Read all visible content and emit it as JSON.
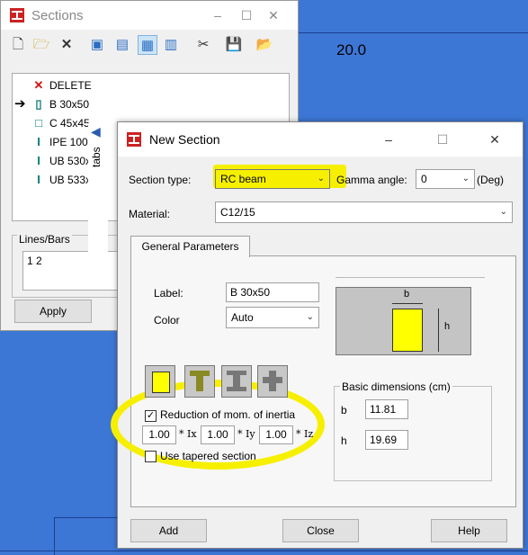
{
  "background": {
    "ruler_value": "20.0"
  },
  "sections_window": {
    "title": "Sections",
    "toolbar_icons": [
      "new-icon",
      "open-folder-icon",
      "delete-x-icon",
      "view-1-icon",
      "view-2-icon",
      "view-3-icon",
      "table-icon",
      "cut-icon",
      "save-icon",
      "folder-new-icon"
    ],
    "items": [
      {
        "label": "DELETE",
        "icon": "delete-x-icon",
        "current": false
      },
      {
        "label": "B 30x50",
        "icon": "rect-icon",
        "current": true
      },
      {
        "label": "C 45x45",
        "icon": "square-icon",
        "current": false
      },
      {
        "label": "IPE 100",
        "icon": "i-beam-icon",
        "current": false
      },
      {
        "label": "UB 530x",
        "icon": "i-beam-icon",
        "current": false
      },
      {
        "label": "UB 533x",
        "icon": "i-beam-icon",
        "current": false
      }
    ],
    "lines_bars_label": "Lines/Bars",
    "lines_bars_value": "1 2",
    "apply_label": "Apply",
    "tabs_label": "tabs"
  },
  "new_section": {
    "title": "New Section",
    "section_type_label": "Section type:",
    "section_type_value": "RC beam",
    "gamma_label": "Gamma angle:",
    "gamma_value": "0",
    "gamma_unit": "(Deg)",
    "material_label": "Material:",
    "material_value": "C12/15",
    "tab_label": "General Parameters",
    "label_label": "Label:",
    "label_value": "B 30x50",
    "color_label": "Color",
    "color_value": "Auto",
    "dims_title": "Basic dimensions (cm)",
    "b_label": "b",
    "b_value": "11.81",
    "h_label": "h",
    "h_value": "19.69",
    "preview_b": "b",
    "preview_h": "h",
    "reduction_label": "Reduction of mom. of inertia",
    "reduction_checked": true,
    "ix_value": "1.00",
    "iy_value": "1.00",
    "iz_value": "1.00",
    "ix_label": "* Ix",
    "iy_label": "* Iy",
    "iz_label": "* Iz",
    "tapered_label": "Use tapered section",
    "add_label": "Add",
    "close_label": "Close",
    "help_label": "Help",
    "highlight_color": "#f6f000",
    "section_fill_color": "#ffff00"
  }
}
